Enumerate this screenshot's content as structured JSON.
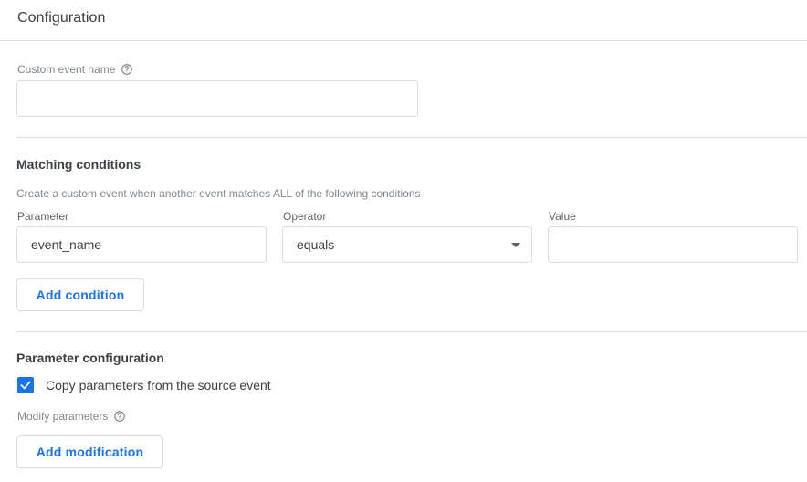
{
  "header": {
    "title": "Configuration"
  },
  "custom_event": {
    "label": "Custom event name",
    "help_icon": "help-circle-icon",
    "value": "",
    "placeholder": ""
  },
  "matching_conditions": {
    "heading": "Matching conditions",
    "description": "Create a custom event when another event matches ALL of the following conditions",
    "parameter": {
      "label": "Parameter",
      "value": "event_name",
      "placeholder": ""
    },
    "operator": {
      "label": "Operator",
      "value": "equals",
      "chevron_icon": "chevron-down-icon"
    },
    "value_field": {
      "label": "Value",
      "value": "",
      "placeholder": ""
    },
    "add_condition_label": "Add condition"
  },
  "parameter_configuration": {
    "heading": "Parameter configuration",
    "copy_parameters": {
      "label": "Copy parameters from the source event",
      "checked": true,
      "check_icon": "check-icon"
    },
    "modify_parameters": {
      "label": "Modify parameters",
      "help_icon": "help-circle-icon"
    },
    "add_modification_label": "Add modification"
  },
  "colors": {
    "accent": "#1a73e8",
    "text_primary": "#3c4043",
    "text_secondary": "#80868b",
    "border": "#dadce0",
    "divider": "#e0e0e0",
    "background": "#ffffff"
  }
}
